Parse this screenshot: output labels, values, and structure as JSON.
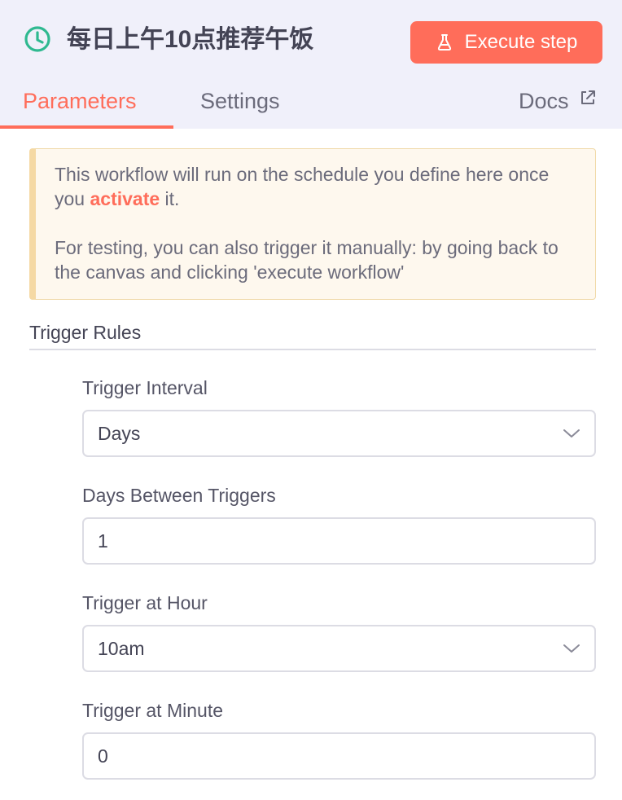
{
  "header": {
    "title": "每日上午10点推荐午饭",
    "execute_button_label": "Execute step",
    "title_icon": "clock-icon",
    "execute_icon": "flask-icon"
  },
  "tabs": [
    {
      "label": "Parameters",
      "active": true
    },
    {
      "label": "Settings",
      "active": false
    }
  ],
  "docs": {
    "label": "Docs",
    "icon": "external-link-icon"
  },
  "notice": {
    "line1_before": "This workflow will run on the schedule you define here once you ",
    "line1_link": "activate",
    "line1_after": " it.",
    "line2": "For testing, you can also trigger it manually: by going back to the canvas and clicking 'execute workflow'"
  },
  "trigger_rules": {
    "title": "Trigger Rules",
    "fields": [
      {
        "label": "Trigger Interval",
        "value": "Days",
        "type": "select"
      },
      {
        "label": "Days Between Triggers",
        "value": "1",
        "type": "input"
      },
      {
        "label": "Trigger at Hour",
        "value": "10am",
        "type": "select"
      },
      {
        "label": "Trigger at Minute",
        "value": "0",
        "type": "input"
      }
    ]
  },
  "colors": {
    "accent": "#ff6d5a",
    "header_bg": "#f0f0fa",
    "notice_bg": "#fef8ee",
    "notice_border": "#f5d9a4",
    "clock_icon": "#2fb990"
  }
}
